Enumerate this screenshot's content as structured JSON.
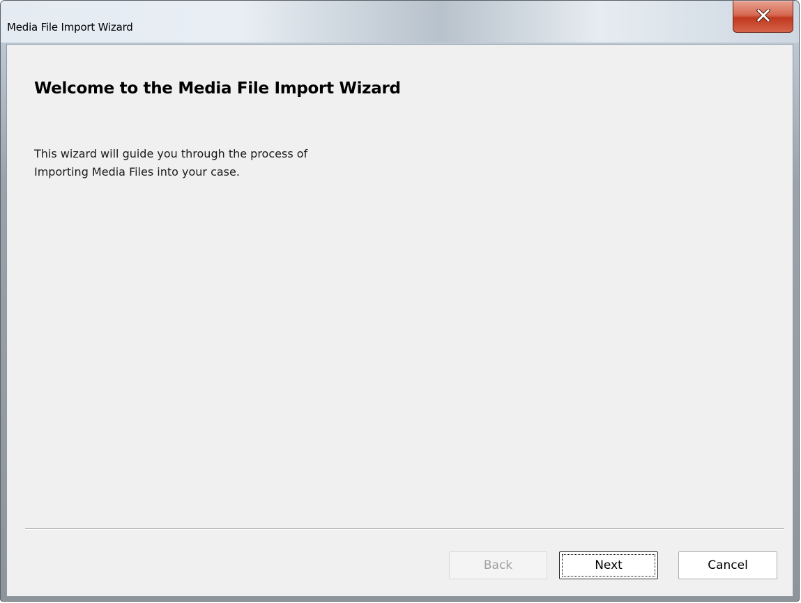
{
  "window": {
    "title": "Media File Import Wizard",
    "close_icon": "close-icon"
  },
  "page": {
    "heading": "Welcome to the Media File Import Wizard",
    "description_lines": [
      "This wizard will guide you through the process of",
      "Importing Media Files into your case."
    ]
  },
  "buttons": {
    "back": {
      "label": "Back",
      "enabled": false
    },
    "next": {
      "label": "Next",
      "enabled": true,
      "focused": true
    },
    "cancel": {
      "label": "Cancel",
      "enabled": true
    }
  },
  "colors": {
    "close_button": "#c7432a",
    "client_background": "#f0f0f0",
    "disabled_text": "#a0a0a0"
  }
}
